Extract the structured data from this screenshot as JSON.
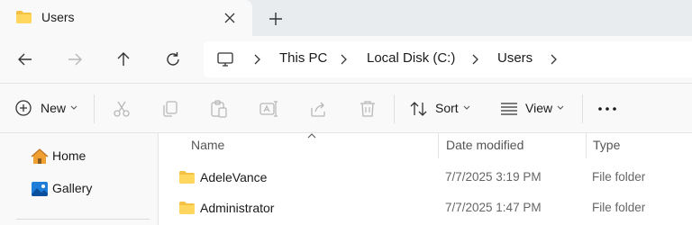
{
  "tab": {
    "title": "Users",
    "folder_color": "#f4c242"
  },
  "address": {
    "crumbs": [
      "This PC",
      "Local Disk (C:)",
      "Users"
    ]
  },
  "commands": {
    "new_label": "New",
    "sort_label": "Sort",
    "view_label": "View"
  },
  "nav": {
    "items": [
      {
        "label": "Home",
        "icon": "home-icon"
      },
      {
        "label": "Gallery",
        "icon": "gallery-icon"
      }
    ]
  },
  "table": {
    "columns": [
      "Name",
      "Date modified",
      "Type"
    ],
    "rows": [
      {
        "name": "AdeleVance",
        "date": "7/7/2025 3:19 PM",
        "type": "File folder"
      },
      {
        "name": "Administrator",
        "date": "7/7/2025 1:47 PM",
        "type": "File folder"
      }
    ]
  },
  "colors": {
    "accent_blue": "#0f6cbd",
    "folder_yellow": "#f4c242",
    "disabled_icon": "#b8b8b8"
  }
}
